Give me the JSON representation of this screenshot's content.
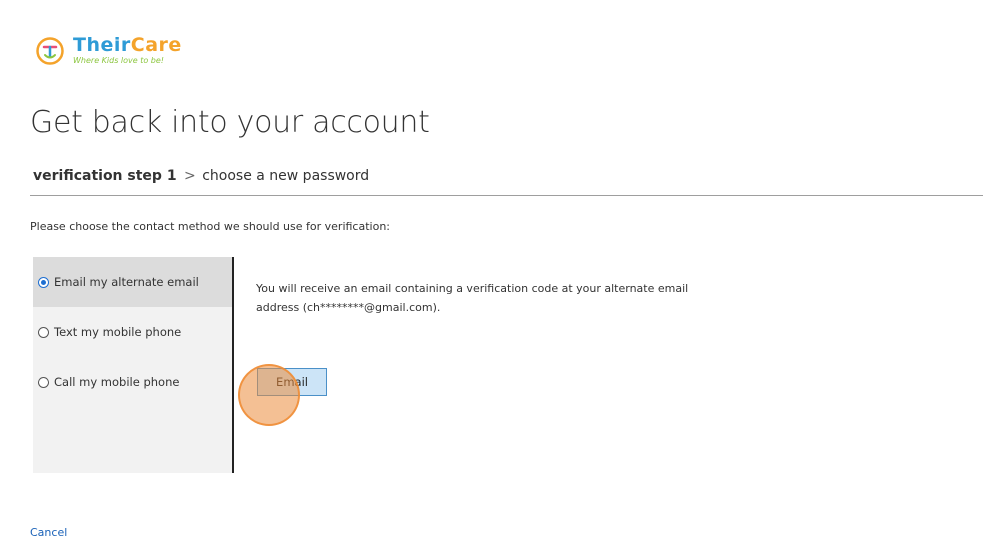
{
  "brand": {
    "name_part1": "Their",
    "name_part2": "Care",
    "tagline": "Where Kids love to be!",
    "logo_glyph": "T"
  },
  "page": {
    "title": "Get back into your account"
  },
  "steps": {
    "current": "verification step 1",
    "separator": ">",
    "next": "choose a new password"
  },
  "instruction": "Please choose the contact method we should use for verification:",
  "methods": [
    {
      "label": "Email my alternate email",
      "selected": true
    },
    {
      "label": "Text my mobile phone",
      "selected": false
    },
    {
      "label": "Call my mobile phone",
      "selected": false
    }
  ],
  "detail": {
    "text": "You will receive an email containing a verification code at your alternate email address (ch********@gmail.com).",
    "button_label": "Email"
  },
  "footer": {
    "cancel_label": "Cancel"
  },
  "colors": {
    "accent": "#1f6fd1",
    "link": "#1a62b8",
    "button_bg": "#cce4f7",
    "button_border": "#4a90c8",
    "selected_bg": "#dcdcdc",
    "panel_bg": "#f2f2f2",
    "marker": "#f08c32"
  }
}
